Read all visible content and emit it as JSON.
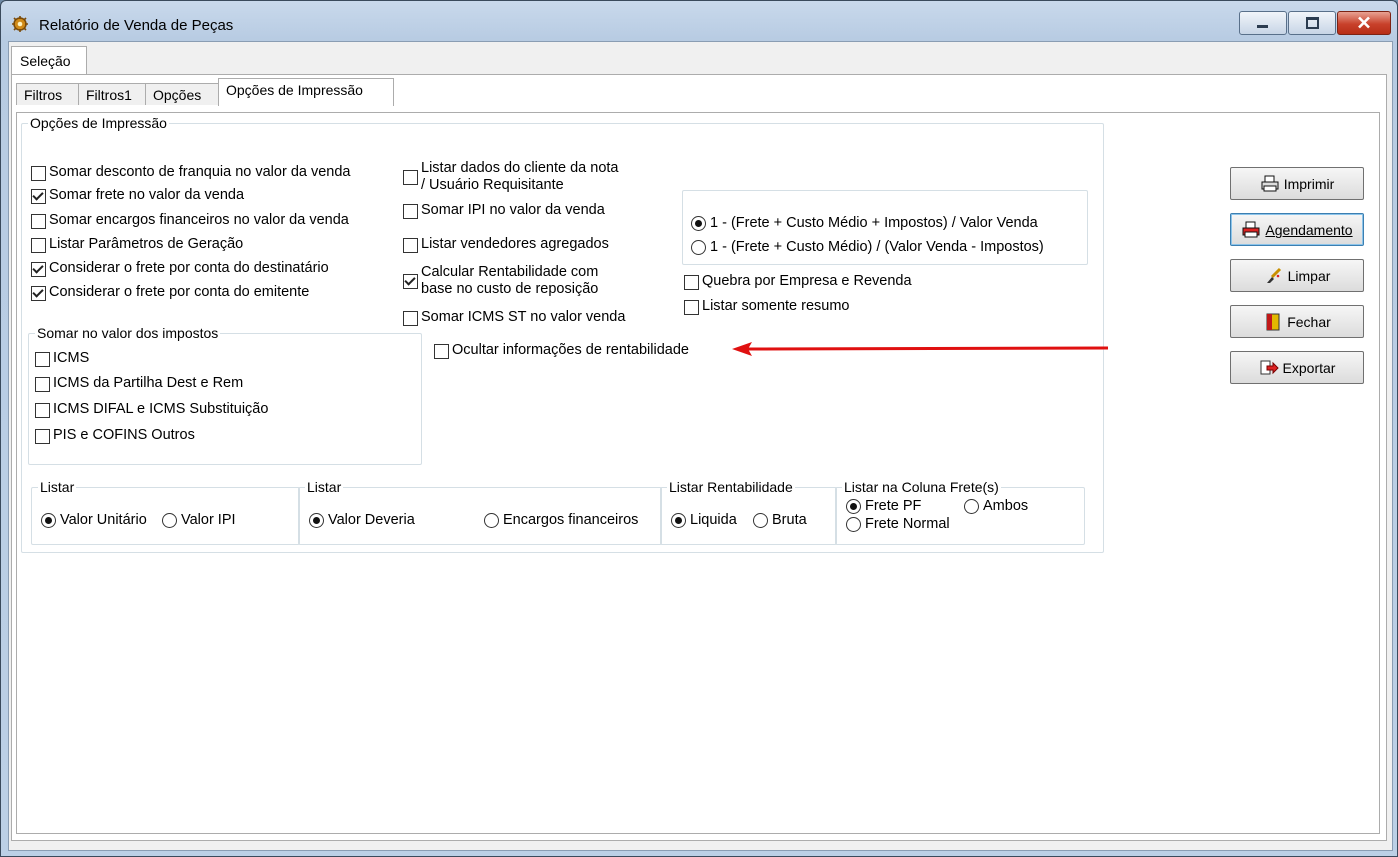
{
  "window": {
    "title": "Relatório de Venda de Peças",
    "controls": [
      "minimize-icon",
      "maximize-icon",
      "close-icon"
    ]
  },
  "outer_tabs": [
    {
      "label": "Seleção"
    }
  ],
  "inner_tabs": [
    {
      "label": "Filtros"
    },
    {
      "label": "Filtros1"
    },
    {
      "label": "Opções"
    },
    {
      "label": "Opções de Impressão",
      "active": true
    }
  ],
  "print_options": {
    "legend": "Opções de Impressão",
    "col1": [
      {
        "label": "Somar desconto de franquia no valor da venda",
        "checked": false
      },
      {
        "label": "Somar frete no valor da venda",
        "checked": true
      },
      {
        "label": "Somar encargos financeiros no valor da venda",
        "checked": false
      },
      {
        "label": "Listar Parâmetros de Geração",
        "checked": false
      },
      {
        "label": "Considerar o frete por conta do destinatário",
        "checked": true
      },
      {
        "label": "Considerar o frete por conta do emitente",
        "checked": true
      }
    ],
    "col2": [
      {
        "label": "Listar dados do cliente da nota",
        "label2": "/ Usuário Requisitante",
        "checked": false
      },
      {
        "label": "Somar IPI no valor da venda",
        "checked": false
      },
      {
        "label": "Listar vendedores agregados",
        "checked": false
      },
      {
        "label": "Calcular Rentabilidade com",
        "label2": "base no custo de reposição",
        "checked": true
      },
      {
        "label": "Somar ICMS ST no valor venda",
        "checked": false
      }
    ],
    "formula_radios": [
      {
        "label": "1 - (Frete + Custo Médio + Impostos) / Valor Venda",
        "selected": true
      },
      {
        "label": "1 - (Frete + Custo Médio) / (Valor Venda - Impostos)",
        "selected": false
      }
    ],
    "col3": [
      {
        "label": "Quebra por Empresa e Revenda",
        "checked": false
      },
      {
        "label": "Listar somente resumo",
        "checked": false
      }
    ],
    "hide_rentability": {
      "label": "Ocultar informações de rentabilidade",
      "checked": false
    },
    "taxes": {
      "legend": "Somar no valor dos impostos",
      "items": [
        {
          "label": "ICMS",
          "checked": false
        },
        {
          "label": "ICMS da Partilha Dest e Rem",
          "checked": false
        },
        {
          "label": "ICMS DIFAL e ICMS Substituição",
          "checked": false
        },
        {
          "label": "PIS e COFINS Outros",
          "checked": false
        }
      ]
    },
    "listar1": {
      "legend": "Listar",
      "options": [
        {
          "label": "Valor Unitário",
          "selected": true
        },
        {
          "label": "Valor IPI",
          "selected": false
        }
      ]
    },
    "listar2": {
      "legend": "Listar",
      "options": [
        {
          "label": "Valor Deveria",
          "selected": true
        },
        {
          "label": "Encargos financeiros",
          "selected": false
        }
      ]
    },
    "rentabilidade": {
      "legend": "Listar Rentabilidade",
      "options": [
        {
          "label": "Liquida",
          "selected": true
        },
        {
          "label": "Bruta",
          "selected": false
        }
      ]
    },
    "frete": {
      "legend": "Listar na Coluna Frete(s)",
      "options": [
        {
          "label": "Frete PF",
          "selected": true
        },
        {
          "label": "Ambos",
          "selected": false
        },
        {
          "label": "Frete Normal",
          "selected": false
        }
      ]
    }
  },
  "buttons": [
    {
      "label": "Imprimir",
      "icon": "printer-icon"
    },
    {
      "label": "Agendamento",
      "icon": "schedule-printer-icon"
    },
    {
      "label": "Limpar",
      "icon": "broom-icon"
    },
    {
      "label": "Fechar",
      "icon": "door-exit-icon"
    },
    {
      "label": "Exportar",
      "icon": "export-arrow-icon"
    }
  ],
  "annotation": {
    "color": "#e01010",
    "icon": "red-arrow-annotation"
  }
}
